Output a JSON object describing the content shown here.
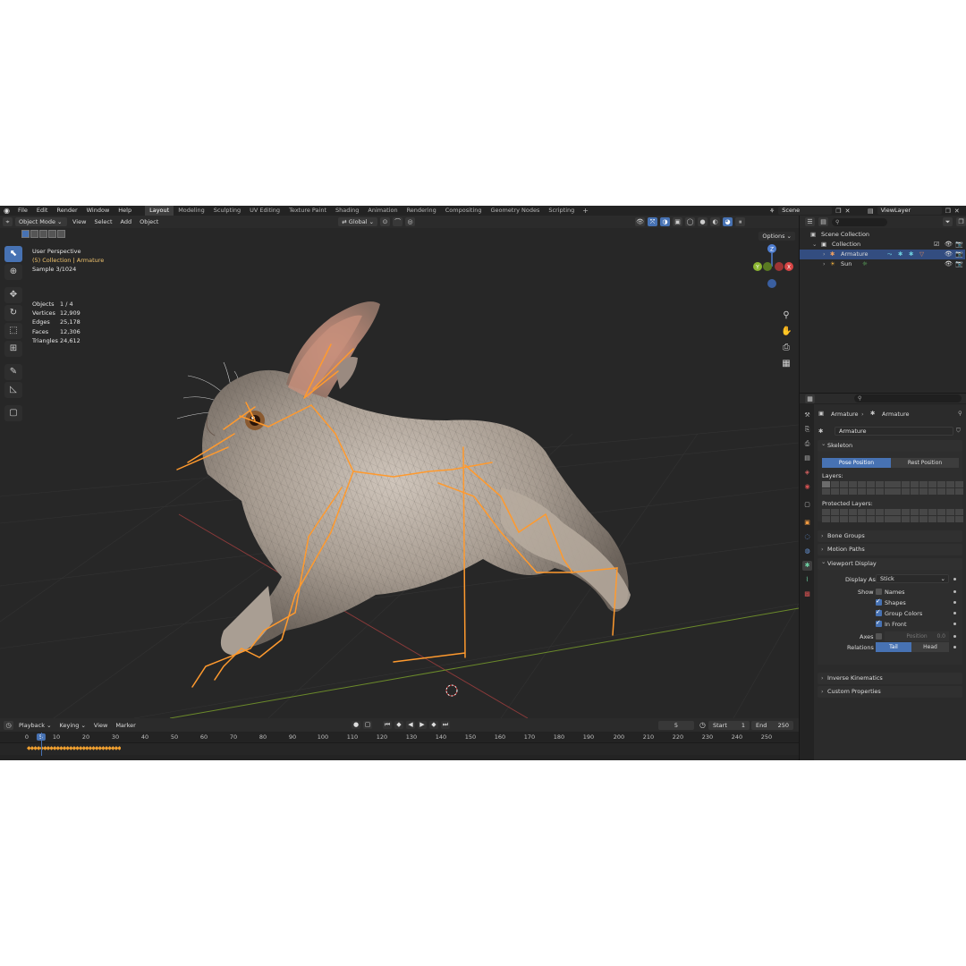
{
  "topbar": {
    "menus": [
      "File",
      "Edit",
      "Render",
      "Window",
      "Help"
    ],
    "workspaces": [
      "Layout",
      "Modeling",
      "Sculpting",
      "UV Editing",
      "Texture Paint",
      "Shading",
      "Animation",
      "Rendering",
      "Compositing",
      "Geometry Nodes",
      "Scripting"
    ],
    "active_workspace": "Layout",
    "scene": "Scene",
    "view_layer": "ViewLayer"
  },
  "viewport_header": {
    "mode": "Object Mode",
    "menus": [
      "View",
      "Select",
      "Add",
      "Object"
    ],
    "transform_orientation": "Global",
    "options": "Options"
  },
  "overlay": {
    "view_name": "User Perspective",
    "collection_line": "(5) Collection | Armature",
    "sample": "Sample 3/1024",
    "stats": [
      {
        "label": "Objects",
        "value": "1 / 4"
      },
      {
        "label": "Vertices",
        "value": "12,909"
      },
      {
        "label": "Edges",
        "value": "25,178"
      },
      {
        "label": "Faces",
        "value": "12,306"
      },
      {
        "label": "Triangles",
        "value": "24,612"
      }
    ]
  },
  "gizmo": {
    "x_label": "X",
    "y_label": "Y",
    "z_label": "Z"
  },
  "timeline": {
    "menus": [
      "Playback",
      "Keying",
      "View",
      "Marker"
    ],
    "current_frame": "5",
    "start_label": "Start",
    "start": "1",
    "end_label": "End",
    "end": "250",
    "ticks": [
      "0",
      "5",
      "10",
      "20",
      "30",
      "40",
      "50",
      "60",
      "70",
      "80",
      "90",
      "100",
      "110",
      "120",
      "130",
      "140",
      "150",
      "160",
      "170",
      "180",
      "190",
      "200",
      "210",
      "220",
      "230",
      "240",
      "250"
    ]
  },
  "outliner": {
    "scene_collection": "Scene Collection",
    "collection": "Collection",
    "items": [
      {
        "name": "Armature",
        "selected": true
      },
      {
        "name": "Sun",
        "selected": false
      }
    ]
  },
  "properties": {
    "breadcrumb_object": "Armature",
    "breadcrumb_data": "Armature",
    "data_name": "Armature",
    "skeleton": {
      "title": "Skeleton",
      "pose_position": "Pose Position",
      "rest_position": "Rest Position",
      "layers": "Layers:",
      "protected_layers": "Protected Layers:"
    },
    "bone_groups": "Bone Groups",
    "motion_paths": "Motion Paths",
    "viewport_display": {
      "title": "Viewport Display",
      "display_as_label": "Display As",
      "display_as_value": "Stick",
      "show_label": "Show",
      "names": "Names",
      "shapes": "Shapes",
      "group_colors": "Group Colors",
      "in_front": "In Front",
      "axes_label": "Axes",
      "position_label": "Position",
      "position_value": "0.0",
      "relations_label": "Relations",
      "tail": "Tail",
      "head": "Head"
    },
    "inverse_kinematics": "Inverse Kinematics",
    "custom_properties": "Custom Properties"
  },
  "colors": {
    "accent": "#4772b3",
    "bone": "#ff9a2e",
    "selection": "#334d80"
  }
}
